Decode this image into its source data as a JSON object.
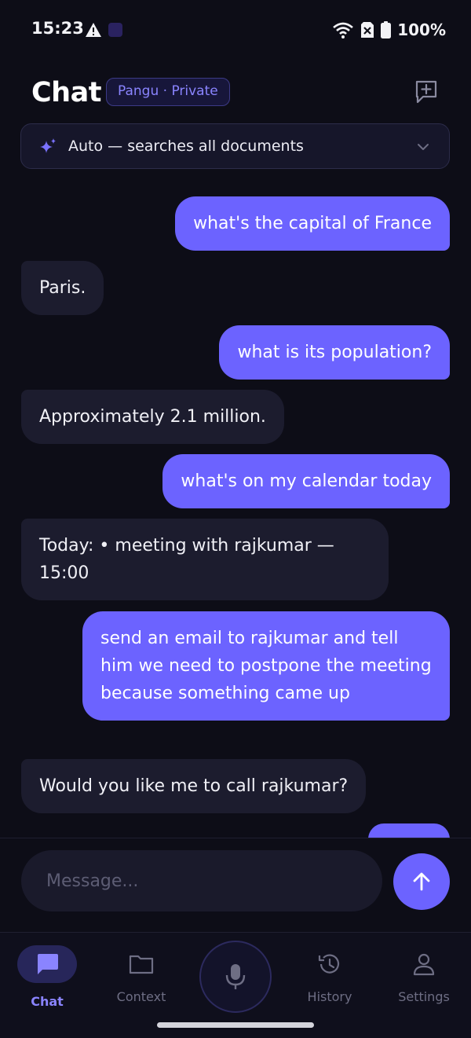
{
  "status_bar": {
    "time": "15:23",
    "battery": "100%"
  },
  "header": {
    "title": "Chat",
    "badge": "Pangu · Private"
  },
  "scope_selector": {
    "label": "Auto — searches all documents"
  },
  "messages": [
    {
      "role": "user",
      "text": "what's the capital of France"
    },
    {
      "role": "assistant",
      "text": "Paris."
    },
    {
      "role": "user",
      "text": "what is its population?"
    },
    {
      "role": "assistant",
      "text": "Approximately 2.1 million."
    },
    {
      "role": "user",
      "text": "what's on my calendar today"
    },
    {
      "role": "assistant",
      "text": "Today: • meeting with rajkumar — 15:00"
    },
    {
      "role": "user",
      "text": "send an email to rajkumar and tell him we need to postpone the meeting because something came up"
    },
    {
      "role": "assistant",
      "text": "Would you like me to call rajkumar?"
    }
  ],
  "composer": {
    "placeholder": "Message..."
  },
  "nav": {
    "chat": "Chat",
    "context": "Context",
    "history": "History",
    "settings": "Settings"
  },
  "colors": {
    "accent": "#6c63ff",
    "background": "#0d0d17",
    "assistant_bubble": "#1c1c2e"
  },
  "icons": [
    "warning-icon",
    "app-notification-icon",
    "wifi-icon",
    "sim-off-icon",
    "battery-icon",
    "new-chat-icon",
    "sparkle-icon",
    "chevron-down-icon",
    "send-arrow-icon",
    "chat-icon",
    "folder-icon",
    "microphone-icon",
    "history-icon",
    "person-icon"
  ]
}
